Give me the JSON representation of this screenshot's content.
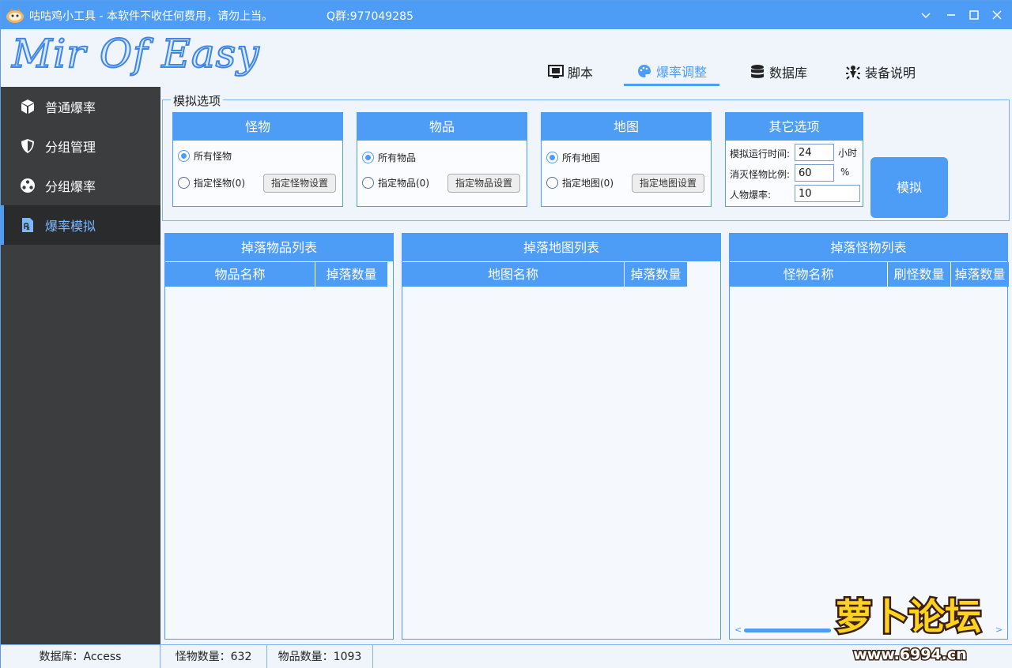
{
  "window": {
    "title": "咕咕鸡小工具 - 本软件不收任何费用，请勿上当。",
    "qq_group": "Q群:977049285",
    "minimize": "—",
    "maximize": "☐",
    "close": "✕"
  },
  "header": {
    "logo": "Mir Of Easy",
    "tabs": [
      {
        "label": "脚本",
        "icon": "monitor-icon"
      },
      {
        "label": "爆率调整",
        "icon": "palette-icon",
        "active": true
      },
      {
        "label": "数据库",
        "icon": "database-icon"
      },
      {
        "label": "装备说明",
        "icon": "bug-icon"
      }
    ]
  },
  "sidebar": {
    "items": [
      {
        "label": "普通爆率",
        "icon": "cube-icon"
      },
      {
        "label": "分组管理",
        "icon": "shield-icon"
      },
      {
        "label": "分组爆率",
        "icon": "dots-circle-icon"
      },
      {
        "label": "爆率模拟",
        "icon": "prescription-file-icon",
        "active": true
      }
    ]
  },
  "options": {
    "legend": "模拟选项",
    "monster": {
      "title": "怪物",
      "radio_all": "所有怪物",
      "radio_specific": "指定怪物(0)",
      "button": "指定怪物设置",
      "selected": "all"
    },
    "item": {
      "title": "物品",
      "radio_all": "所有物品",
      "radio_specific": "指定物品(0)",
      "button": "指定物品设置",
      "selected": "all"
    },
    "map": {
      "title": "地图",
      "radio_all": "所有地图",
      "radio_specific": "指定地图(0)",
      "button": "指定地图设置",
      "selected": "all"
    },
    "other": {
      "title": "其它选项",
      "run_time_label": "模拟运行时间:",
      "run_time_value": "24",
      "run_time_unit": "小时",
      "kill_ratio_label": "消灭怪物比例:",
      "kill_ratio_value": "60",
      "kill_ratio_unit": "%",
      "player_rate_label": "人物爆率:",
      "player_rate_value": "10"
    },
    "simulate_button": "模拟"
  },
  "lists": {
    "items": {
      "title": "掉落物品列表",
      "columns": [
        "物品名称",
        "掉落数量"
      ]
    },
    "maps": {
      "title": "掉落地图列表",
      "columns": [
        "地图名称",
        "掉落数量"
      ]
    },
    "monsters": {
      "title": "掉落怪物列表",
      "columns": [
        "怪物名称",
        "刷怪数量",
        "掉落数量"
      ]
    }
  },
  "status": {
    "database": "数据库：Access",
    "monster_count": "怪物数量：632",
    "item_count": "物品数量：1093"
  },
  "watermark": {
    "brand": "萝卜论坛",
    "url": "www.6994.cn"
  }
}
